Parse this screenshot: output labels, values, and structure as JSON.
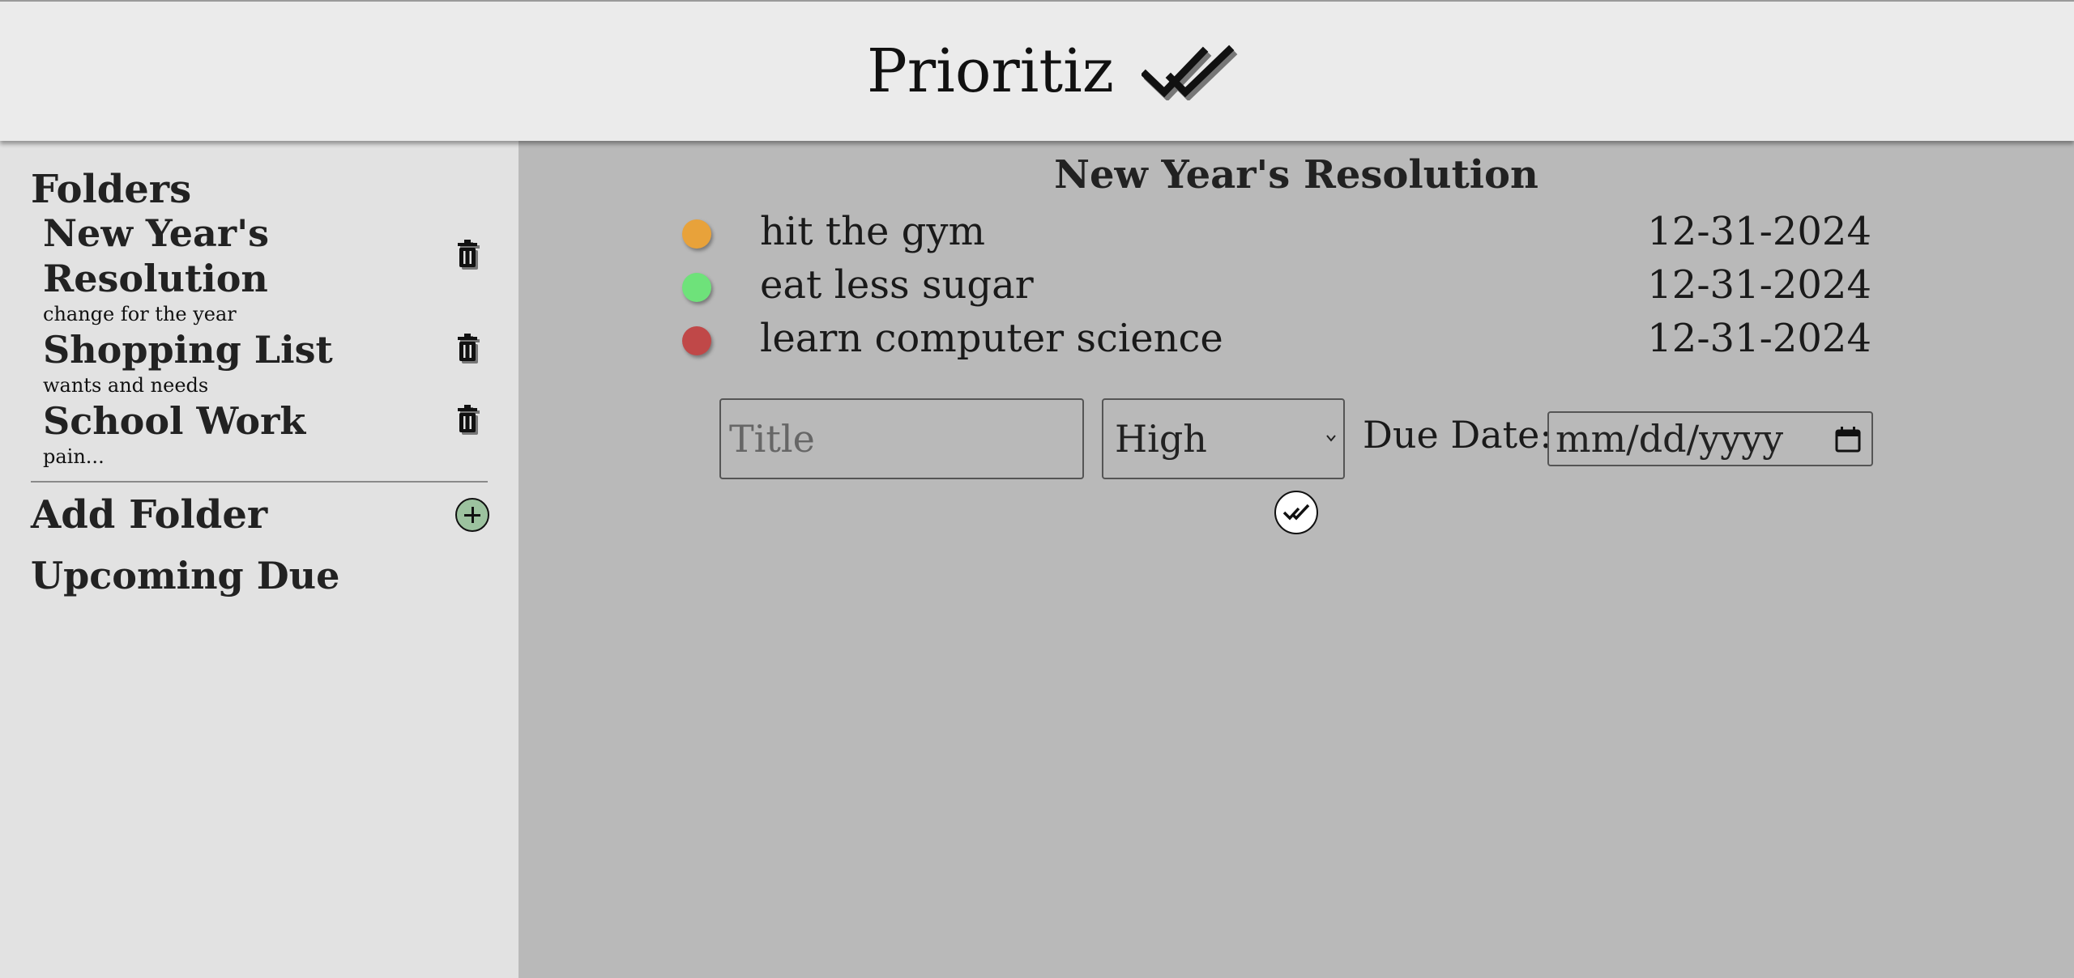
{
  "app": {
    "title": "Prioritiz",
    "logo_icon": "double-check-icon"
  },
  "sidebar": {
    "heading": "Folders",
    "folders": [
      {
        "name": "New Year's Resolution",
        "description": "change for the year",
        "delete_icon": "trash-icon"
      },
      {
        "name": "Shopping List",
        "description": "wants and needs",
        "delete_icon": "trash-icon"
      },
      {
        "name": "School Work",
        "description": "pain...",
        "delete_icon": "trash-icon"
      }
    ],
    "add_folder_label": "Add Folder",
    "add_icon": "plus-circle-icon",
    "upcoming_label": "Upcoming Due"
  },
  "main": {
    "folder_title": "New Year's Resolution",
    "tasks": [
      {
        "title": "hit the gym",
        "due": "12-31-2024",
        "priority_color": "#e8a23a"
      },
      {
        "title": "eat less sugar",
        "due": "12-31-2024",
        "priority_color": "#6ee27a"
      },
      {
        "title": "learn computer science",
        "due": "12-31-2024",
        "priority_color": "#c04848"
      }
    ],
    "form": {
      "title_placeholder": "Title",
      "priority_value": "High",
      "due_label": "Due Date:",
      "date_placeholder": "mm/dd/yyyy",
      "submit_icon": "check-circle-icon"
    }
  },
  "colors": {
    "header_bg": "#ebebeb",
    "sidebar_bg": "#e2e2e2",
    "main_bg": "#b9b9b9",
    "add_button": "#9cc29f"
  }
}
